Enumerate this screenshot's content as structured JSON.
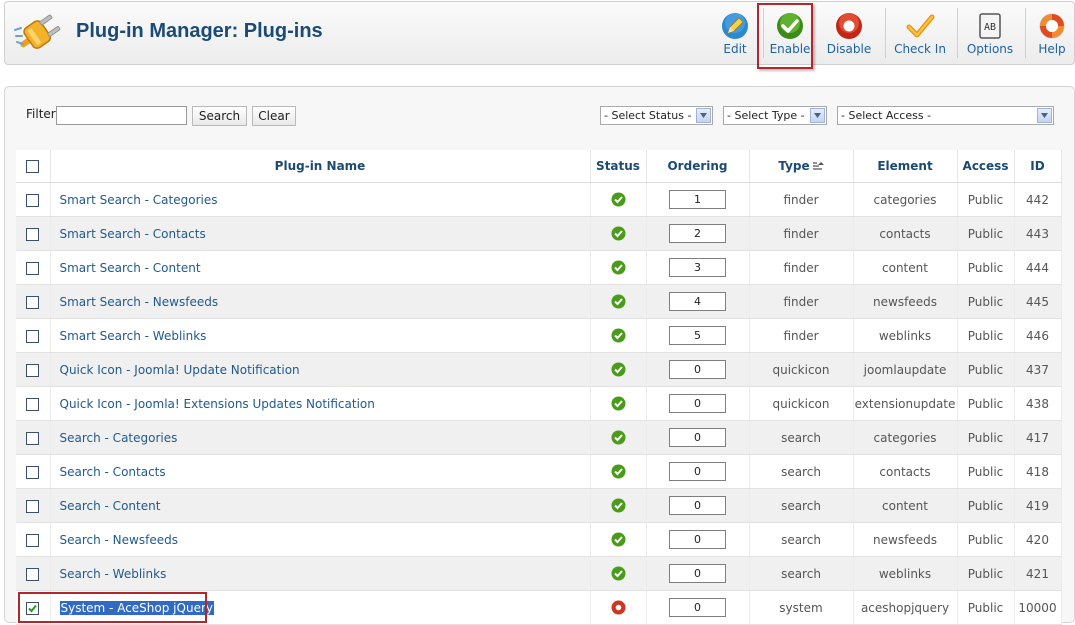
{
  "header": {
    "title": "Plug-in Manager: Plug-ins"
  },
  "toolbar": {
    "edit_label": "Edit",
    "enable_label": "Enable",
    "disable_label": "Disable",
    "checkin_label": "Check In",
    "options_label": "Options",
    "options_icon_text": "AB",
    "help_label": "Help"
  },
  "filter": {
    "label": "Filter:",
    "value": "",
    "search_label": "Search",
    "clear_label": "Clear",
    "status_select": "- Select Status -",
    "type_select": "- Select Type -",
    "access_select": "- Select Access -"
  },
  "table": {
    "columns": {
      "name": "Plug-in Name",
      "status": "Status",
      "ordering": "Ordering",
      "type": "Type",
      "element": "Element",
      "access": "Access",
      "id": "ID"
    },
    "rows": [
      {
        "name": "Smart Search - Categories",
        "status": "enabled",
        "ordering": "1",
        "type": "finder",
        "element": "categories",
        "access": "Public",
        "id": "442",
        "checked": false
      },
      {
        "name": "Smart Search - Contacts",
        "status": "enabled",
        "ordering": "2",
        "type": "finder",
        "element": "contacts",
        "access": "Public",
        "id": "443",
        "checked": false
      },
      {
        "name": "Smart Search - Content",
        "status": "enabled",
        "ordering": "3",
        "type": "finder",
        "element": "content",
        "access": "Public",
        "id": "444",
        "checked": false
      },
      {
        "name": "Smart Search - Newsfeeds",
        "status": "enabled",
        "ordering": "4",
        "type": "finder",
        "element": "newsfeeds",
        "access": "Public",
        "id": "445",
        "checked": false
      },
      {
        "name": "Smart Search - Weblinks",
        "status": "enabled",
        "ordering": "5",
        "type": "finder",
        "element": "weblinks",
        "access": "Public",
        "id": "446",
        "checked": false
      },
      {
        "name": "Quick Icon - Joomla! Update Notification",
        "status": "enabled",
        "ordering": "0",
        "type": "quickicon",
        "element": "joomlaupdate",
        "access": "Public",
        "id": "437",
        "checked": false
      },
      {
        "name": "Quick Icon - Joomla! Extensions Updates Notification",
        "status": "enabled",
        "ordering": "0",
        "type": "quickicon",
        "element": "extensionupdate",
        "access": "Public",
        "id": "438",
        "checked": false
      },
      {
        "name": "Search - Categories",
        "status": "enabled",
        "ordering": "0",
        "type": "search",
        "element": "categories",
        "access": "Public",
        "id": "417",
        "checked": false
      },
      {
        "name": "Search - Contacts",
        "status": "enabled",
        "ordering": "0",
        "type": "search",
        "element": "contacts",
        "access": "Public",
        "id": "418",
        "checked": false
      },
      {
        "name": "Search - Content",
        "status": "enabled",
        "ordering": "0",
        "type": "search",
        "element": "content",
        "access": "Public",
        "id": "419",
        "checked": false
      },
      {
        "name": "Search - Newsfeeds",
        "status": "enabled",
        "ordering": "0",
        "type": "search",
        "element": "newsfeeds",
        "access": "Public",
        "id": "420",
        "checked": false
      },
      {
        "name": "Search - Weblinks",
        "status": "enabled",
        "ordering": "0",
        "type": "search",
        "element": "weblinks",
        "access": "Public",
        "id": "421",
        "checked": false
      },
      {
        "name": "System - AceShop jQuery",
        "status": "disabled",
        "ordering": "0",
        "type": "system",
        "element": "aceshopjquery",
        "access": "Public",
        "id": "10000",
        "checked": true
      }
    ]
  },
  "colors": {
    "title": "#1b4a74",
    "link": "#1e5a8e",
    "enabled_green": "#4a9a1c",
    "disabled_red": "#d2341f",
    "highlight_red": "#b3262b",
    "selection_blue": "#316ac5"
  }
}
